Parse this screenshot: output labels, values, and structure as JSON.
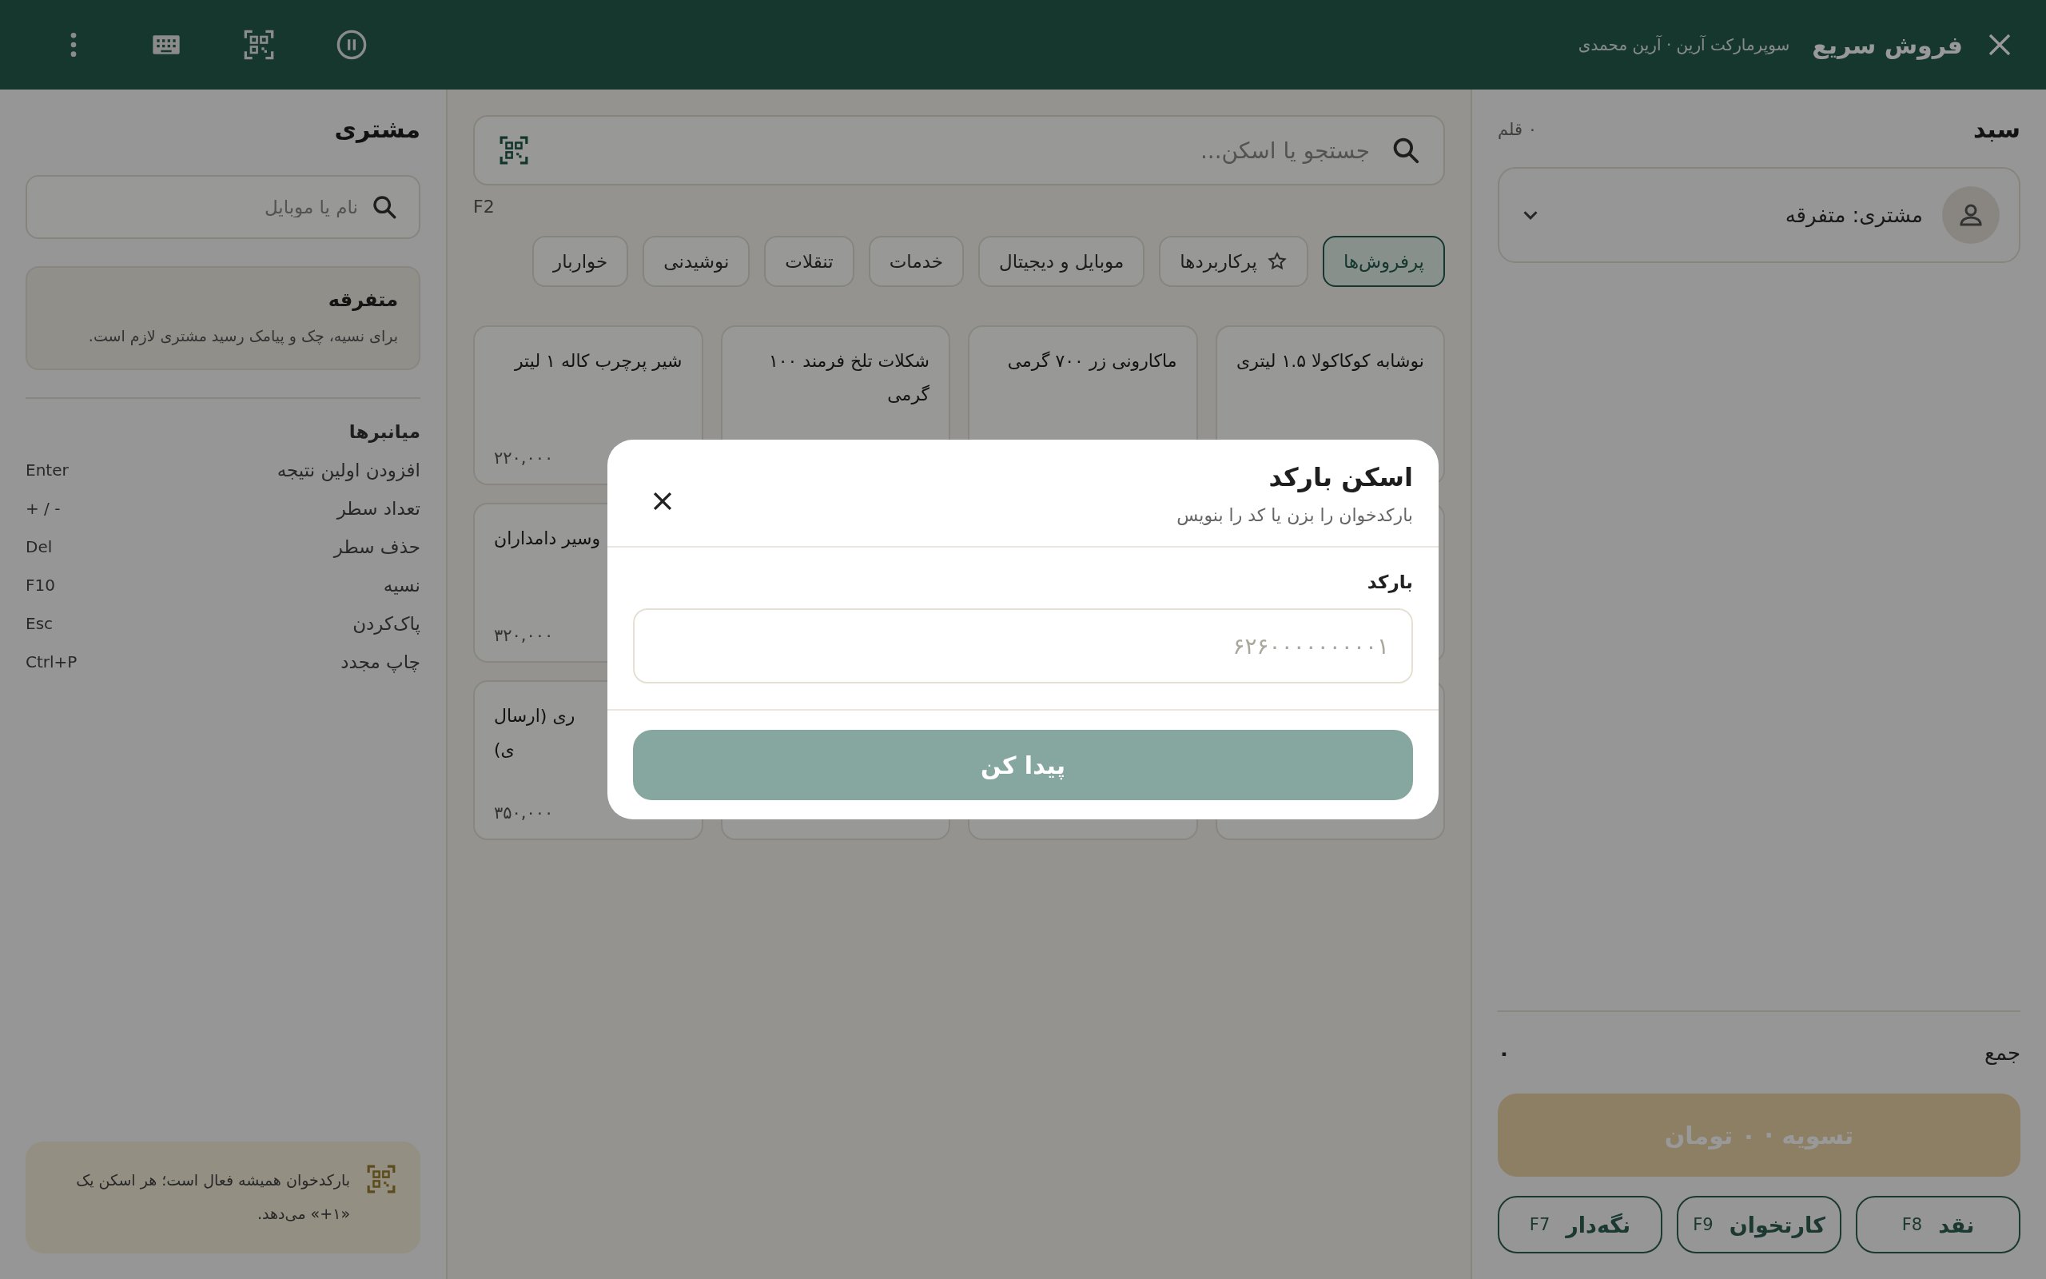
{
  "app_bar": {
    "title": "فروش سریع",
    "subtitle": "سوپرمارکت آرین · آرین محمدی"
  },
  "cart": {
    "title": "سبد",
    "item_count": "۰ قلم",
    "customer": "مشتری: متفرقه",
    "total_label": "جمع",
    "total_value": "۰",
    "settle_button": {
      "label": "تسویه · ۰ تومان",
      "disabled": true
    },
    "payment_buttons": [
      {
        "label": "نقد",
        "key": "F8"
      },
      {
        "label": "کارتخوان",
        "key": "F9"
      },
      {
        "label": "نگه‌دار",
        "key": "F7"
      }
    ]
  },
  "catalog": {
    "search": {
      "placeholder": "جستجو یا اسکن..."
    },
    "search_shortcut": "F2",
    "categories": [
      {
        "label": "پرفروش‌ها",
        "selected": true,
        "kind": "plain"
      },
      {
        "label": "پرکاربردها",
        "selected": false,
        "kind": "starred"
      },
      {
        "label": "موبایل و دیجیتال",
        "selected": false,
        "kind": "plain"
      },
      {
        "label": "خدمات",
        "selected": false,
        "kind": "plain"
      },
      {
        "label": "تنقلات",
        "selected": false,
        "kind": "plain"
      },
      {
        "label": "نوشیدنی",
        "selected": false,
        "kind": "plain"
      },
      {
        "label": "خواربار",
        "selected": false,
        "kind": "plain"
      }
    ],
    "product_rows": [
      [
        {
          "kind": "full",
          "name": "نوشابه کوکاکولا ۱.۵ لیتری"
        },
        {
          "kind": "full",
          "name": "ماکارونی زر ۷۰۰ گرمی"
        },
        {
          "kind": "full",
          "name": "شکلات تلخ فرمند ۱۰۰ گرمی"
        },
        {
          "kind": "full",
          "name": "شیر پرچرب کاله ۱ لیتر",
          "price": "۲۲۰,۰۰۰"
        }
      ],
      [
        {
          "kind": "clipped",
          "name": "وسیر دامداران",
          "price": "۳۲۰,۰۰۰"
        }
      ],
      [
        {
          "kind": "clipped",
          "name": "ری (ارسال\nی)",
          "price": "۳۵۰,۰۰۰"
        }
      ]
    ]
  },
  "customer_panel": {
    "title": "مشتری",
    "search": {
      "placeholder": "نام یا موبایل"
    },
    "selected_customer": {
      "name": "متفرقه",
      "note": "برای نسیه، چک و پیامک رسید مشتری لازم است."
    },
    "shortcuts_title": "میانبرها",
    "shortcuts": [
      {
        "action": "افزودن اولین نتیجه",
        "key": "Enter"
      },
      {
        "action": "تعداد سطر",
        "key": "+ / -"
      },
      {
        "action": "حذف سطر",
        "key": "Del"
      },
      {
        "action": "نسیه",
        "key": "F10"
      },
      {
        "action": "پاک‌کردن",
        "key": "Esc"
      },
      {
        "action": "چاپ مجدد",
        "key": "Ctrl+P"
      }
    ],
    "scanner_hint": "بارکدخوان همیشه فعال است؛ هر اسکن یک «۱+» می‌دهد."
  },
  "dialog": {
    "title": "اسکن بارکد",
    "subtitle": "بارکدخوان را بزن یا کد را بنویس",
    "field_label": "بارکد",
    "field": {
      "placeholder": "۶۲۶۰۰۰۰۰۰۰۰۰۱"
    },
    "submit_button": {
      "label": "پیدا کن",
      "disabled": true
    }
  }
}
